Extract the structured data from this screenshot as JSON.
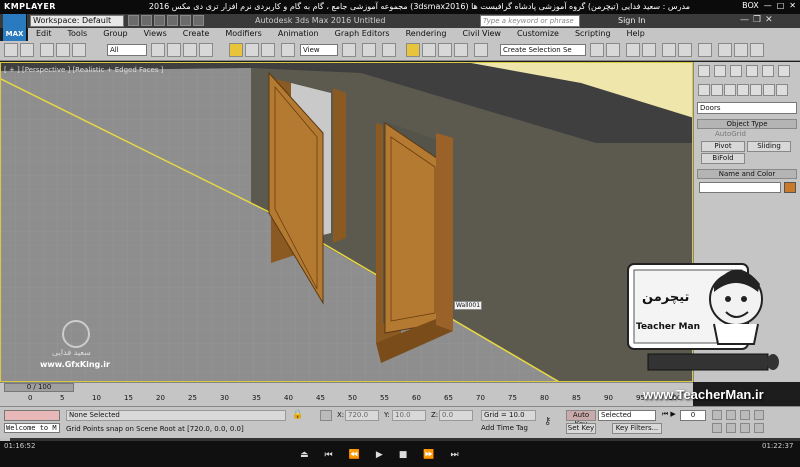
{
  "player": {
    "name": "KMPLAYER",
    "caption": "مجموعه آموزشی جامع ، گام به گام و کاربردی نرم افزار تری دی مکس 2016 (3dsmax2016)   مدرس : سعید فدایی (تیچرمن) گروه آموزشی پادشاه گرافیست ها",
    "right_label": "BOX",
    "time_elapsed": "01:16:52",
    "time_total": "01:22:37"
  },
  "app": {
    "logo": "MAX",
    "workspace": "Workspace: Default",
    "title": "Autodesk 3ds Max 2016    Untitled",
    "search_placeholder": "Type a keyword or phrase",
    "signin": "Sign In"
  },
  "menu": [
    "Edit",
    "Tools",
    "Group",
    "Views",
    "Create",
    "Modifiers",
    "Animation",
    "Graph Editors",
    "Rendering",
    "Civil View",
    "Customize",
    "Scripting",
    "Help"
  ],
  "toolbar": {
    "filter": "All",
    "ref_coord": "View",
    "selection_set": "Create Selection Se"
  },
  "viewport": {
    "label": "[ + ] [Perspective ] [Realistic + Edged Faces ]",
    "tooltip": "Wall001"
  },
  "command_panel": {
    "category": "Doors",
    "object_type_title": "Object Type",
    "autogrid": "AutoGrid",
    "buttons": [
      "Pivot",
      "Sliding",
      "BiFold"
    ],
    "name_color_title": "Name and Color"
  },
  "timeline": {
    "slider": "0 / 100",
    "ticks": [
      "0",
      "5",
      "10",
      "15",
      "20",
      "25",
      "30",
      "35",
      "40",
      "45",
      "50",
      "55",
      "60",
      "65",
      "70",
      "75",
      "80",
      "85",
      "90",
      "95",
      "100"
    ]
  },
  "status": {
    "maxscript": "Welcome to M",
    "selection": "None Selected",
    "prompt": "Grid Points snap on Scene Root at [720.0, 0.0, 0.0]",
    "x_label": "X:",
    "x_val": "720.0",
    "y_label": "Y:",
    "y_val": "10.0",
    "z_label": "Z:",
    "z_val": "0.0",
    "grid": "Grid = 10.0",
    "add_time_tag": "Add Time Tag",
    "auto_key": "Auto Key",
    "set_key": "Set Key",
    "selected": "Selected",
    "key_filters": "Key Filters...",
    "frame": "0"
  },
  "watermarks": {
    "website": "www.TeacherMan.ir",
    "gfx_site": "www.GfxKing.ir",
    "gfx_name": "سعید فدایی",
    "teacherman": "Teacher Man",
    "teacherman_fa": "تیچرمن"
  }
}
